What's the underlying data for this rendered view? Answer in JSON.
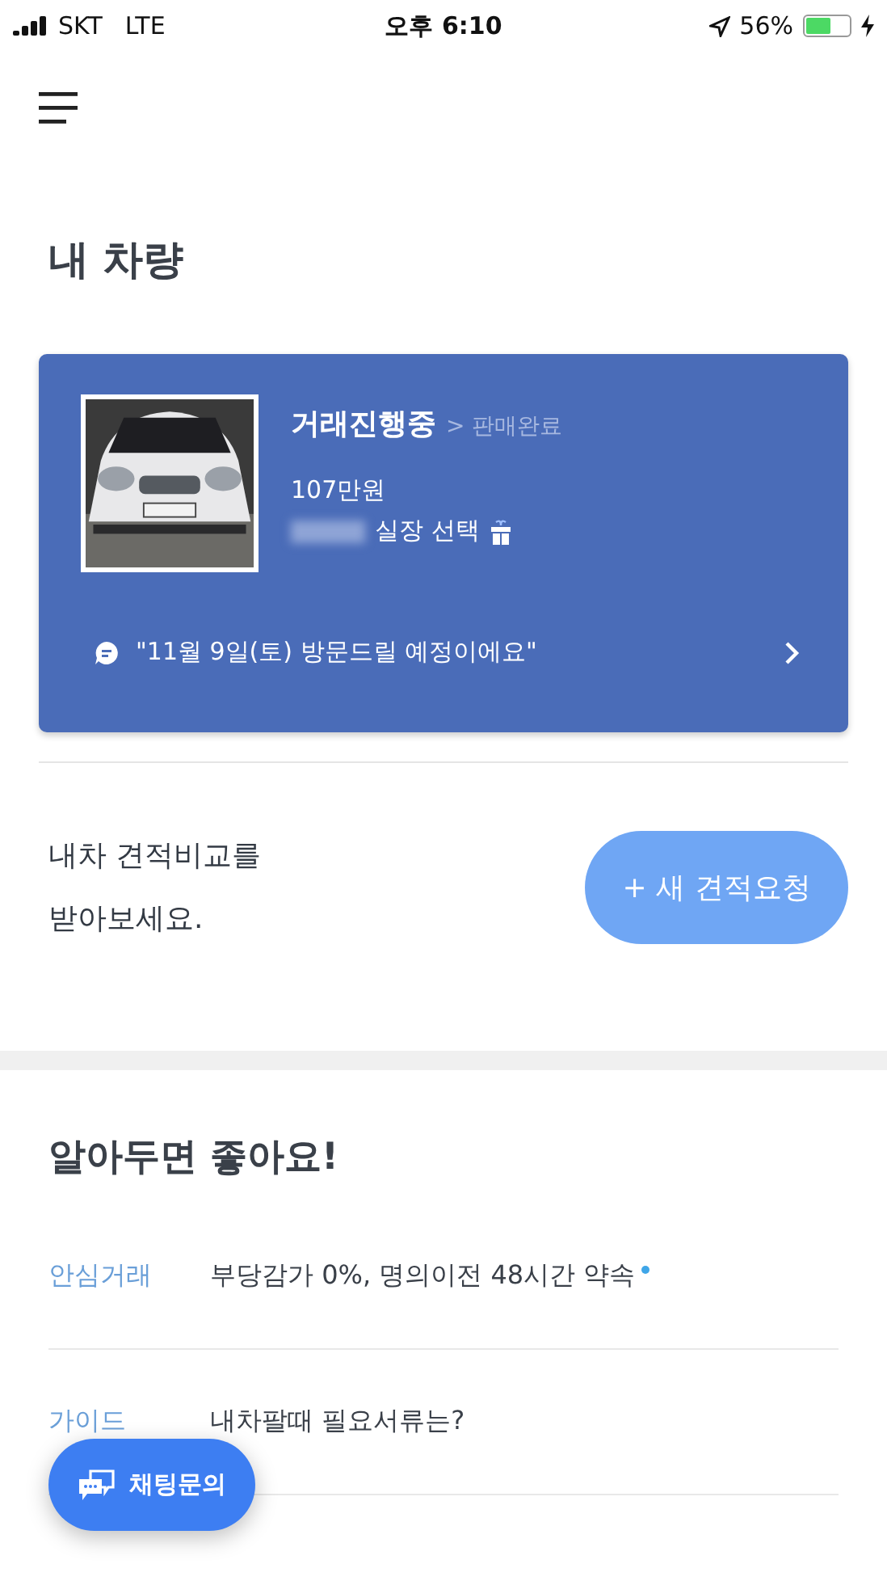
{
  "status_bar": {
    "carrier": "SKT",
    "network": "LTE",
    "time": "오후 6:10",
    "battery": "56%"
  },
  "title": "내 차량",
  "car_card": {
    "status": "거래진행중",
    "next_status": "> 판매완료",
    "price": "107만원",
    "dealer": "실장 선택",
    "message": "\"11월 9일(토) 방문드릴 예정이에요\""
  },
  "estimate": {
    "prompt_lines": [
      "내차 견적비교를",
      "받아보세요."
    ],
    "button": "+ 새 견적요청"
  },
  "tips": {
    "title": "알아두면 좋아요!",
    "items": [
      {
        "category": "안심거래",
        "text": "부당감가 0%, 명의이전 48시간 약속",
        "new": true
      },
      {
        "category": "가이드",
        "text": "내차팔때 필요서류는?",
        "new": false
      }
    ]
  },
  "chat_button": "채팅문의"
}
